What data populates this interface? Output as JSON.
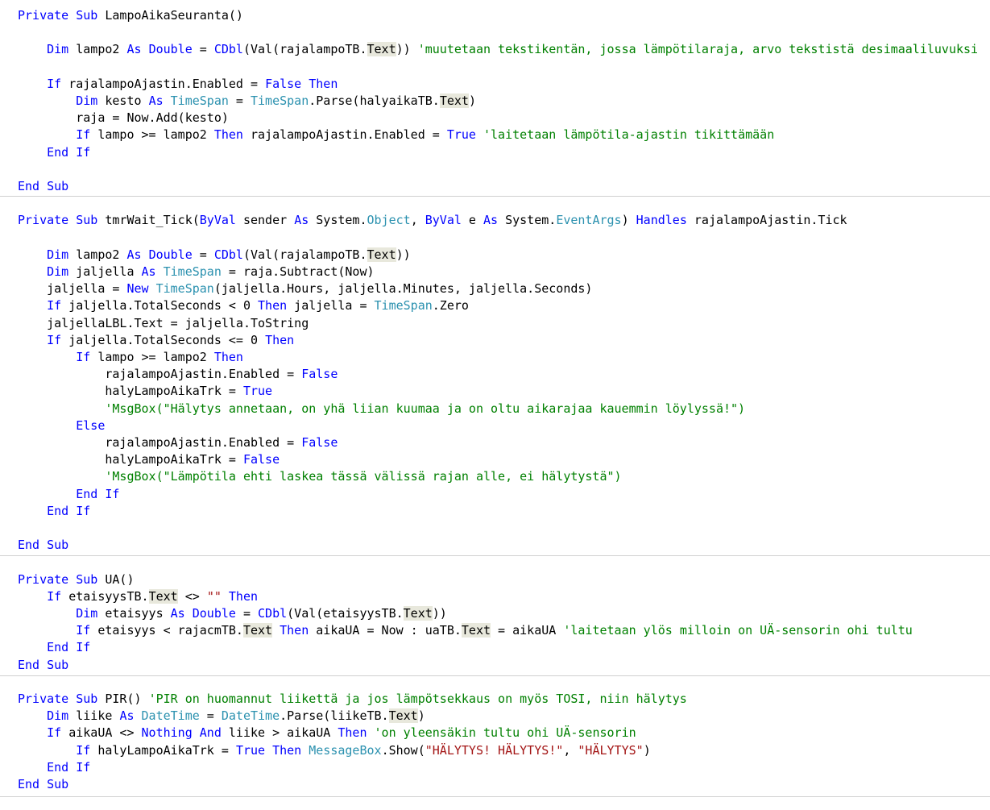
{
  "colors": {
    "keyword": "#0000ff",
    "type": "#2b91af",
    "comment": "#008000",
    "string": "#a31515",
    "text": "#000000",
    "highlight": "#e8e8dc",
    "separator": "#d0d0d0"
  },
  "lines": [
    [
      [
        "k",
        "Private Sub"
      ],
      [
        "p",
        " LampoAikaSeuranta()"
      ]
    ],
    [],
    [
      [
        "p",
        "    "
      ],
      [
        "k",
        "Dim"
      ],
      [
        "p",
        " lampo2 "
      ],
      [
        "k",
        "As"
      ],
      [
        "p",
        " "
      ],
      [
        "k",
        "Double"
      ],
      [
        "p",
        " = "
      ],
      [
        "k",
        "CDbl"
      ],
      [
        "p",
        "(Val(rajalampoTB."
      ],
      [
        "h",
        "Text"
      ],
      [
        "p",
        ")) "
      ],
      [
        "c",
        "'muutetaan tekstikentän, jossa lämpötilaraja, arvo tekstistä desimaaliluvuksi"
      ]
    ],
    [],
    [
      [
        "p",
        "    "
      ],
      [
        "k",
        "If"
      ],
      [
        "p",
        " rajalampoAjastin.Enabled = "
      ],
      [
        "k",
        "False"
      ],
      [
        "p",
        " "
      ],
      [
        "k",
        "Then"
      ]
    ],
    [
      [
        "p",
        "        "
      ],
      [
        "k",
        "Dim"
      ],
      [
        "p",
        " kesto "
      ],
      [
        "k",
        "As"
      ],
      [
        "p",
        " "
      ],
      [
        "t",
        "TimeSpan"
      ],
      [
        "p",
        " = "
      ],
      [
        "t",
        "TimeSpan"
      ],
      [
        "p",
        ".Parse(halyaikaTB."
      ],
      [
        "h",
        "Text"
      ],
      [
        "p",
        ")"
      ]
    ],
    [
      [
        "p",
        "        raja = Now.Add(kesto)"
      ]
    ],
    [
      [
        "p",
        "        "
      ],
      [
        "k",
        "If"
      ],
      [
        "p",
        " lampo >= lampo2 "
      ],
      [
        "k",
        "Then"
      ],
      [
        "p",
        " rajalampoAjastin.Enabled = "
      ],
      [
        "k",
        "True"
      ],
      [
        "p",
        " "
      ],
      [
        "c",
        "'laitetaan lämpötila-ajastin tikittämään"
      ]
    ],
    [
      [
        "p",
        "    "
      ],
      [
        "k",
        "End If"
      ]
    ],
    [],
    [
      [
        "k",
        "End Sub"
      ]
    ],
    [],
    [
      [
        "k",
        "Private Sub"
      ],
      [
        "p",
        " tmrWait_Tick("
      ],
      [
        "k",
        "ByVal"
      ],
      [
        "p",
        " sender "
      ],
      [
        "k",
        "As"
      ],
      [
        "p",
        " System."
      ],
      [
        "t",
        "Object"
      ],
      [
        "p",
        ", "
      ],
      [
        "k",
        "ByVal"
      ],
      [
        "p",
        " e "
      ],
      [
        "k",
        "As"
      ],
      [
        "p",
        " System."
      ],
      [
        "t",
        "EventArgs"
      ],
      [
        "p",
        ") "
      ],
      [
        "k",
        "Handles"
      ],
      [
        "p",
        " rajalampoAjastin.Tick"
      ]
    ],
    [],
    [
      [
        "p",
        "    "
      ],
      [
        "k",
        "Dim"
      ],
      [
        "p",
        " lampo2 "
      ],
      [
        "k",
        "As"
      ],
      [
        "p",
        " "
      ],
      [
        "k",
        "Double"
      ],
      [
        "p",
        " = "
      ],
      [
        "k",
        "CDbl"
      ],
      [
        "p",
        "(Val(rajalampoTB."
      ],
      [
        "h",
        "Text"
      ],
      [
        "p",
        "))"
      ]
    ],
    [
      [
        "p",
        "    "
      ],
      [
        "k",
        "Dim"
      ],
      [
        "p",
        " jaljella "
      ],
      [
        "k",
        "As"
      ],
      [
        "p",
        " "
      ],
      [
        "t",
        "TimeSpan"
      ],
      [
        "p",
        " = raja.Subtract(Now)"
      ]
    ],
    [
      [
        "p",
        "    jaljella = "
      ],
      [
        "k",
        "New"
      ],
      [
        "p",
        " "
      ],
      [
        "t",
        "TimeSpan"
      ],
      [
        "p",
        "(jaljella.Hours, jaljella.Minutes, jaljella.Seconds)"
      ]
    ],
    [
      [
        "p",
        "    "
      ],
      [
        "k",
        "If"
      ],
      [
        "p",
        " jaljella.TotalSeconds < 0 "
      ],
      [
        "k",
        "Then"
      ],
      [
        "p",
        " jaljella = "
      ],
      [
        "t",
        "TimeSpan"
      ],
      [
        "p",
        ".Zero"
      ]
    ],
    [
      [
        "p",
        "    jaljellaLBL.Text = jaljella.ToString"
      ]
    ],
    [
      [
        "p",
        "    "
      ],
      [
        "k",
        "If"
      ],
      [
        "p",
        " jaljella.TotalSeconds <= 0 "
      ],
      [
        "k",
        "Then"
      ]
    ],
    [
      [
        "p",
        "        "
      ],
      [
        "k",
        "If"
      ],
      [
        "p",
        " lampo >= lampo2 "
      ],
      [
        "k",
        "Then"
      ]
    ],
    [
      [
        "p",
        "            rajalampoAjastin.Enabled = "
      ],
      [
        "k",
        "False"
      ]
    ],
    [
      [
        "p",
        "            halyLampoAikaTrk = "
      ],
      [
        "k",
        "True"
      ]
    ],
    [
      [
        "p",
        "            "
      ],
      [
        "c",
        "'MsgBox(\"Hälytys annetaan, on yhä liian kuumaa ja on oltu aikarajaa kauemmin löylyssä!\")"
      ]
    ],
    [
      [
        "p",
        "        "
      ],
      [
        "k",
        "Else"
      ]
    ],
    [
      [
        "p",
        "            rajalampoAjastin.Enabled = "
      ],
      [
        "k",
        "False"
      ]
    ],
    [
      [
        "p",
        "            halyLampoAikaTrk = "
      ],
      [
        "k",
        "False"
      ]
    ],
    [
      [
        "p",
        "            "
      ],
      [
        "c",
        "'MsgBox(\"Lämpötila ehti laskea tässä välissä rajan alle, ei hälytystä\")"
      ]
    ],
    [
      [
        "p",
        "        "
      ],
      [
        "k",
        "End If"
      ]
    ],
    [
      [
        "p",
        "    "
      ],
      [
        "k",
        "End If"
      ]
    ],
    [],
    [
      [
        "k",
        "End Sub"
      ]
    ],
    [],
    [
      [
        "k",
        "Private Sub"
      ],
      [
        "p",
        " UA()"
      ]
    ],
    [
      [
        "p",
        "    "
      ],
      [
        "k",
        "If"
      ],
      [
        "p",
        " etaisyysTB."
      ],
      [
        "h",
        "Text"
      ],
      [
        "p",
        " <> "
      ],
      [
        "s",
        "\"\""
      ],
      [
        "p",
        " "
      ],
      [
        "k",
        "Then"
      ]
    ],
    [
      [
        "p",
        "        "
      ],
      [
        "k",
        "Dim"
      ],
      [
        "p",
        " etaisyys "
      ],
      [
        "k",
        "As"
      ],
      [
        "p",
        " "
      ],
      [
        "k",
        "Double"
      ],
      [
        "p",
        " = "
      ],
      [
        "k",
        "CDbl"
      ],
      [
        "p",
        "(Val(etaisyysTB."
      ],
      [
        "h",
        "Text"
      ],
      [
        "p",
        "))"
      ]
    ],
    [
      [
        "p",
        "        "
      ],
      [
        "k",
        "If"
      ],
      [
        "p",
        " etaisyys < rajacmTB."
      ],
      [
        "h",
        "Text"
      ],
      [
        "p",
        " "
      ],
      [
        "k",
        "Then"
      ],
      [
        "p",
        " aikaUA = Now : uaTB."
      ],
      [
        "h",
        "Text"
      ],
      [
        "p",
        " = aikaUA "
      ],
      [
        "c",
        "'laitetaan ylös milloin on UÄ-sensorin ohi tultu"
      ]
    ],
    [
      [
        "p",
        "    "
      ],
      [
        "k",
        "End If"
      ]
    ],
    [
      [
        "k",
        "End Sub"
      ]
    ],
    [],
    [
      [
        "k",
        "Private Sub"
      ],
      [
        "p",
        " PIR() "
      ],
      [
        "c",
        "'PIR on huomannut liikettä ja jos lämpötsekkaus on myös TOSI, niin hälytys"
      ]
    ],
    [
      [
        "p",
        "    "
      ],
      [
        "k",
        "Dim"
      ],
      [
        "p",
        " liike "
      ],
      [
        "k",
        "As"
      ],
      [
        "p",
        " "
      ],
      [
        "t",
        "DateTime"
      ],
      [
        "p",
        " = "
      ],
      [
        "t",
        "DateTime"
      ],
      [
        "p",
        ".Parse(liikeTB."
      ],
      [
        "h",
        "Text"
      ],
      [
        "p",
        ")"
      ]
    ],
    [
      [
        "p",
        "    "
      ],
      [
        "k",
        "If"
      ],
      [
        "p",
        " aikaUA <> "
      ],
      [
        "k",
        "Nothing"
      ],
      [
        "p",
        " "
      ],
      [
        "k",
        "And"
      ],
      [
        "p",
        " liike > aikaUA "
      ],
      [
        "k",
        "Then"
      ],
      [
        "p",
        " "
      ],
      [
        "c",
        "'on yleensäkin tultu ohi UÄ-sensorin"
      ]
    ],
    [
      [
        "p",
        "        "
      ],
      [
        "k",
        "If"
      ],
      [
        "p",
        " halyLampoAikaTrk = "
      ],
      [
        "k",
        "True"
      ],
      [
        "p",
        " "
      ],
      [
        "k",
        "Then"
      ],
      [
        "p",
        " "
      ],
      [
        "t",
        "MessageBox"
      ],
      [
        "p",
        ".Show("
      ],
      [
        "s",
        "\"HÄLYTYS! HÄLYTYS!\""
      ],
      [
        "p",
        ", "
      ],
      [
        "s",
        "\"HÄLYTYS\""
      ],
      [
        "p",
        ")"
      ]
    ],
    [
      [
        "p",
        "    "
      ],
      [
        "k",
        "End If"
      ]
    ],
    [
      [
        "k",
        "End Sub"
      ]
    ]
  ]
}
